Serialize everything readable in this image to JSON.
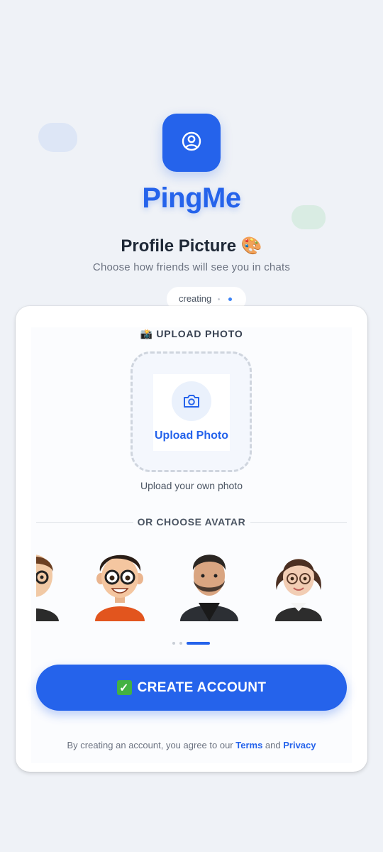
{
  "app": {
    "name": "PingMe",
    "accent_color": "#2563eb"
  },
  "header": {
    "title": "Profile Picture 🎨",
    "subtitle": "Choose how friends will see you in chats",
    "status": "creating"
  },
  "upload": {
    "section_label": "📸 UPLOAD PHOTO",
    "button_label": "Upload Photo",
    "caption": "Upload your own photo",
    "icon": "camera-icon"
  },
  "avatars": {
    "divider_label": "OR CHOOSE AVATAR",
    "items": [
      {
        "name": "avatar-partial",
        "icon": "avatar-man-glasses"
      },
      {
        "name": "avatar-boy-glasses",
        "icon": "avatar-boy-glasses"
      },
      {
        "name": "avatar-man-beard",
        "icon": "avatar-man-beard"
      },
      {
        "name": "avatar-woman-glasses",
        "icon": "avatar-woman-glasses"
      }
    ],
    "page_count": 3,
    "active_page": 3
  },
  "cta": {
    "label": "CREATE ACCOUNT",
    "icon": "check-mark-icon"
  },
  "terms": {
    "prefix": "By creating an account, you agree to our ",
    "terms_link": "Terms",
    "middle": " and ",
    "privacy_link": "Privacy"
  }
}
